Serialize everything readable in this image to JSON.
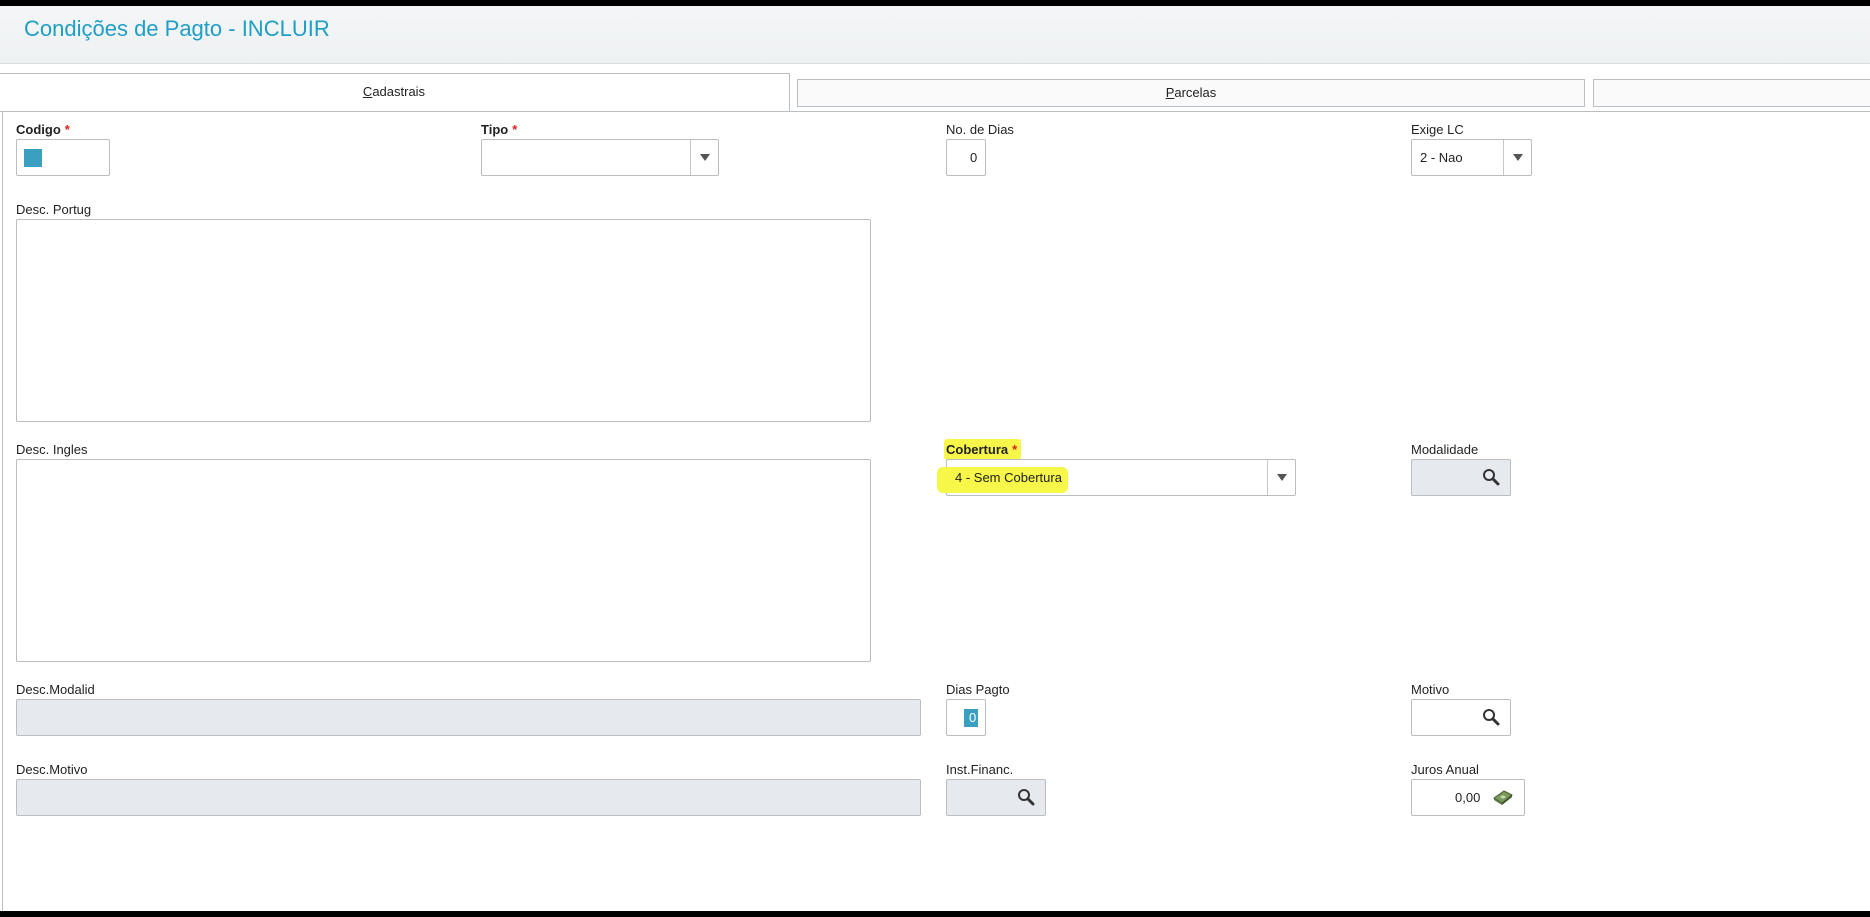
{
  "window": {
    "title": "Condições de Pagto - INCLUIR"
  },
  "tabs": [
    {
      "label": "Cadastrais",
      "underline": "C",
      "rest": "adastrais",
      "active": true
    },
    {
      "label": "Parcelas",
      "underline": "P",
      "rest": "arcelas",
      "active": false
    },
    {
      "label": "",
      "active": false
    }
  ],
  "fields": {
    "codigo": {
      "label": "Codigo",
      "required_mark": "*",
      "value": ""
    },
    "tipo": {
      "label": "Tipo",
      "required_mark": "*",
      "value": ""
    },
    "no_dias": {
      "label": "No. de Dias",
      "value": "0"
    },
    "exige_lc": {
      "label": "Exige LC",
      "value": "2 - Nao"
    },
    "desc_portug": {
      "label": "Desc. Portug",
      "value": ""
    },
    "desc_ingles": {
      "label": "Desc. Ingles",
      "value": ""
    },
    "cobertura": {
      "label": "Cobertura",
      "required_mark": "*",
      "value": "4 - Sem Cobertura"
    },
    "modalidade": {
      "label": "Modalidade",
      "value": ""
    },
    "desc_modalid": {
      "label": "Desc.Modalid",
      "value": ""
    },
    "dias_pagto": {
      "label": "Dias Pagto",
      "value": "0"
    },
    "motivo": {
      "label": "Motivo",
      "value": ""
    },
    "desc_motivo": {
      "label": "Desc.Motivo",
      "value": ""
    },
    "inst_financ": {
      "label": "Inst.Financ.",
      "value": ""
    },
    "juros_anual": {
      "label": "Juros Anual",
      "value": "0,00"
    }
  },
  "colors": {
    "accent": "#1f9ec7",
    "required": "#e02020",
    "highlight": "#f7f74a",
    "readonly_bg": "#e6e9ee",
    "cursor": "#3a9fc0"
  },
  "icons": {
    "lookup": "search-icon",
    "dropdown": "chevron-down-icon",
    "calculator": "money-icon"
  }
}
